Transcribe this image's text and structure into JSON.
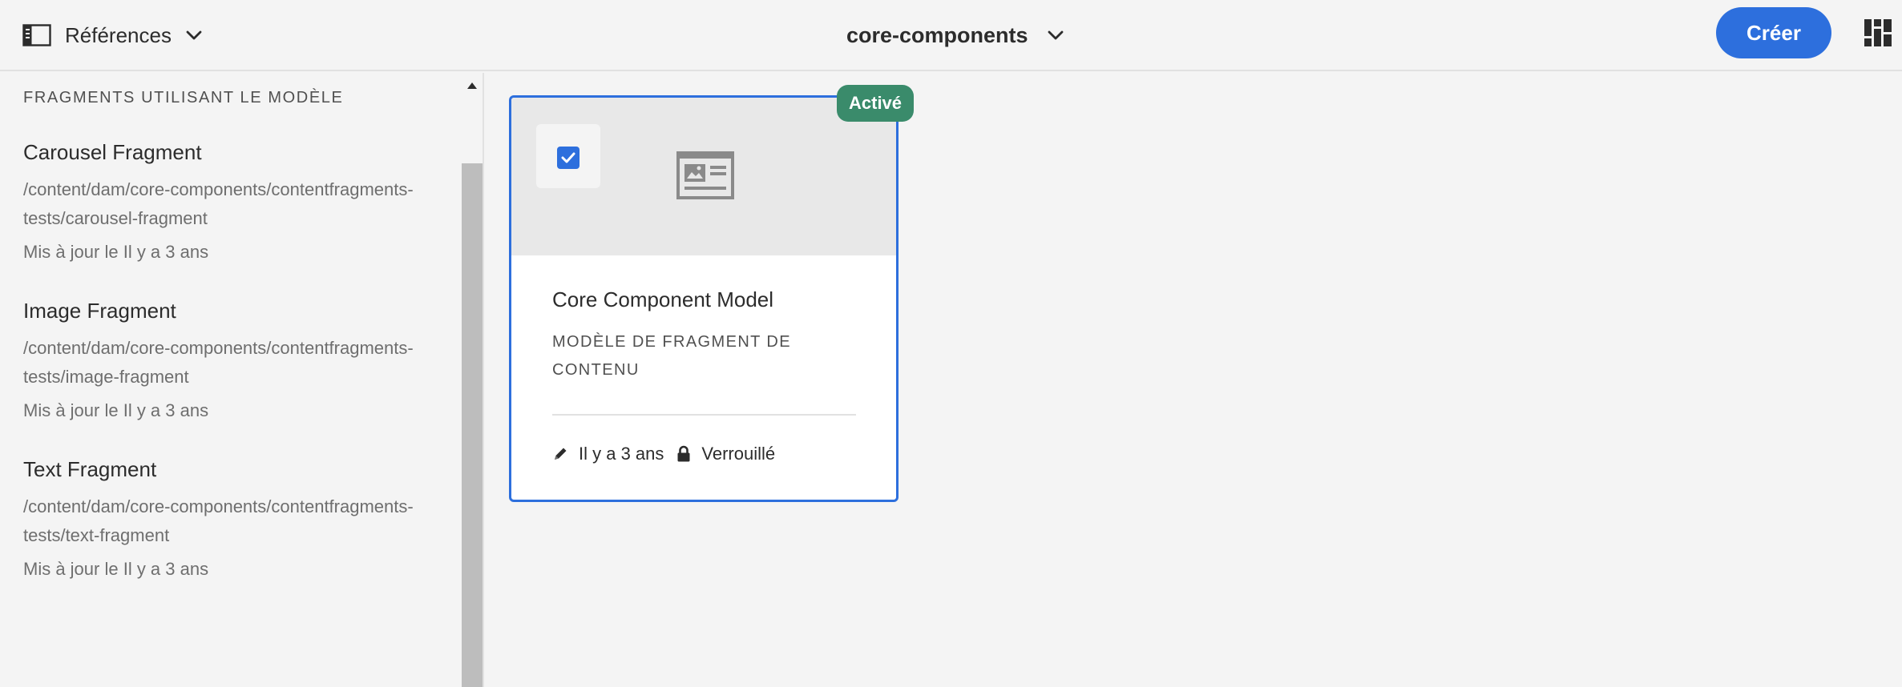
{
  "header": {
    "rail_label": "Références",
    "title": "core-components",
    "create_label": "Créer",
    "accent_color": "#2d6fdd"
  },
  "rail": {
    "heading": "FRAGMENTS UTILISANT LE MODÈLE",
    "items": [
      {
        "title": "Carousel Fragment",
        "path_1": "/content/dam/core-components/contentfragments-",
        "path_2": "tests/carousel-fragment",
        "meta": "Mis à jour le Il y a 3 ans"
      },
      {
        "title": "Image Fragment",
        "path_1": "/content/dam/core-components/contentfragments-",
        "path_2": "tests/image-fragment",
        "meta": "Mis à jour le Il y a 3 ans"
      },
      {
        "title": "Text Fragment",
        "path_1": "/content/dam/core-components/contentfragments-",
        "path_2": "tests/text-fragment",
        "meta": "Mis à jour le Il y a 3 ans"
      }
    ]
  },
  "card": {
    "status": "Activé",
    "status_color": "#3a8b6b",
    "title": "Core Component Model",
    "subtitle": "MODÈLE DE FRAGMENT DE CONTENU",
    "modified": "Il y a 3 ans",
    "lock_label": "Verrouillé",
    "selected": true,
    "thumbnail_icon": "content-fragment-model-icon"
  }
}
